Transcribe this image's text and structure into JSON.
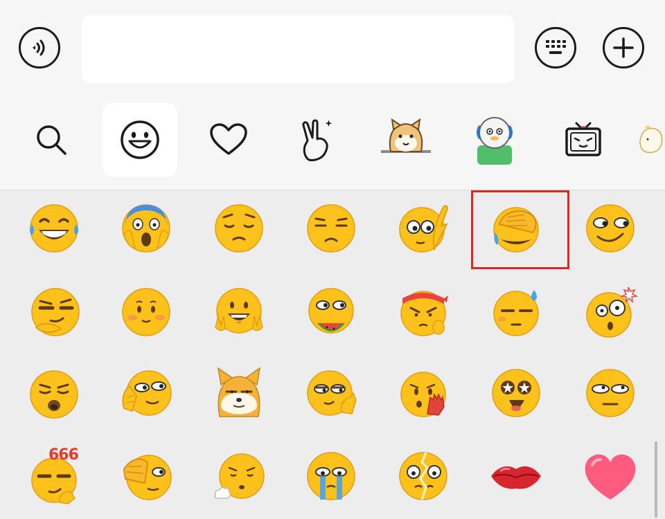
{
  "input_bar": {
    "voice_icon": "voice-wave-icon",
    "text_value": "",
    "keyboard_icon": "keyboard-icon",
    "add_icon": "plus-icon"
  },
  "tabs": [
    {
      "name": "search",
      "icon": "search-icon",
      "active": false
    },
    {
      "name": "emoji",
      "icon": "smiley-icon",
      "active": true
    },
    {
      "name": "favorites",
      "icon": "heart-icon",
      "active": false
    },
    {
      "name": "stickers",
      "icon": "peace-hand-icon",
      "active": false
    },
    {
      "name": "shiba-sticker-pack",
      "icon": "shiba-dog-icon",
      "active": false
    },
    {
      "name": "duck-sticker-pack",
      "icon": "duck-icon",
      "active": false
    },
    {
      "name": "tv-sticker-pack",
      "icon": "tv-icon",
      "active": false
    },
    {
      "name": "partial-sticker-pack",
      "icon": "sticker-icon",
      "active": false
    }
  ],
  "emoji_grid": [
    [
      "tears-of-joy",
      "scream",
      "pensive",
      "unamused",
      "facepalm-peek",
      "facepalm",
      "side-eye-smirk"
    ],
    [
      "smug-stroke-chin",
      "shy-blush",
      "peace-grin",
      "watermelon-eat",
      "angry-headband",
      "sweat-neutral",
      "shocked-spark"
    ],
    [
      "kiss-blow",
      "hand-cover-peek",
      "doge",
      "ok-hand-smirk",
      "hand-over-mouth",
      "star-struck",
      "eye-roll"
    ],
    [
      "666-smirk",
      "hand-salute-peek",
      "sigh-puff",
      "crying-stream",
      "cracked-face",
      "kiss-lips",
      "pink-heart"
    ]
  ],
  "badge_666": "666",
  "colors": {
    "emoji_yellow": "#fcc21b",
    "emoji_outline": "#e39d10",
    "highlight_red": "#e0261d",
    "active_tab_bg": "#ffffff",
    "panel_bg": "#ededed"
  },
  "selected_emoji": "facepalm"
}
